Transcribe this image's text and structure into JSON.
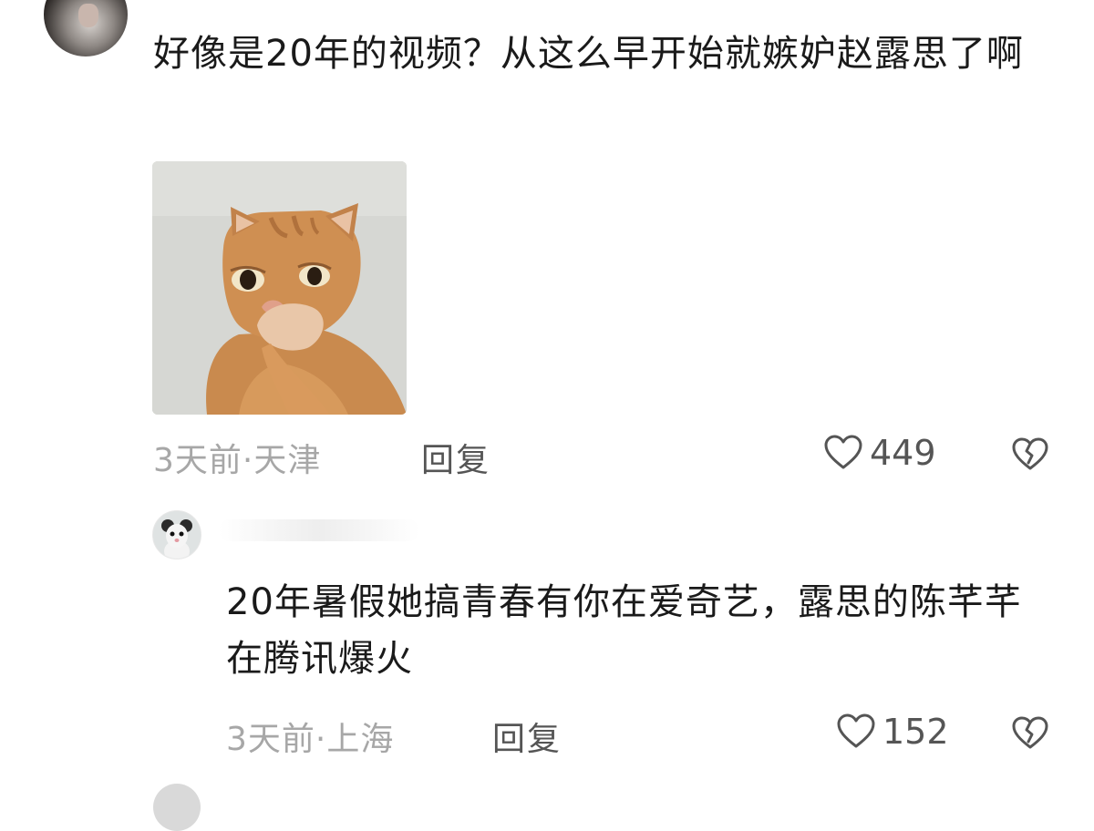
{
  "comments": [
    {
      "text": "好像是20年的视频？从这么早开始就嫉妒赵露思了啊",
      "time": "3天前",
      "location": "天津",
      "meta": "3天前·天津",
      "reply_label": "回复",
      "likes": "449",
      "has_image": true,
      "image_icon": "cat-sticker"
    },
    {
      "text": "20年暑假她搞青春有你在爱奇艺，露思的陈芊芊在腾讯爆火",
      "time": "3天前",
      "location": "上海",
      "meta": "3天前·上海",
      "reply_label": "回复",
      "likes": "152",
      "is_reply": true
    }
  ],
  "icons": {
    "like": "heart-outline-icon",
    "dislike": "broken-heart-icon"
  },
  "colors": {
    "text": "#1a1a1a",
    "meta": "#a7a7a7",
    "action": "#555555",
    "background": "#ffffff"
  }
}
